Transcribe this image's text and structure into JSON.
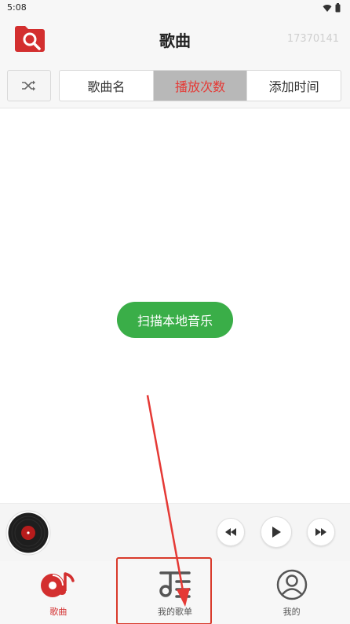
{
  "status_bar": {
    "time": "5:08"
  },
  "header": {
    "title": "歌曲",
    "user_id": "17370141"
  },
  "sort_bar": {
    "tabs": [
      {
        "label": "歌曲名",
        "active": false
      },
      {
        "label": "播放次数",
        "active": true
      },
      {
        "label": "添加时间",
        "active": false
      }
    ]
  },
  "content": {
    "scan_button_label": "扫描本地音乐"
  },
  "bottom_nav": {
    "items": [
      {
        "label": "歌曲",
        "icon": "song-disc-icon",
        "active": true
      },
      {
        "label": "我的歌单",
        "icon": "playlist-icon",
        "active": false
      },
      {
        "label": "我的",
        "icon": "profile-icon",
        "active": false
      }
    ]
  },
  "colors": {
    "accent_red": "#d32f2f",
    "active_tab_text": "#e53935",
    "scan_button_green": "#3aae48",
    "highlight_box": "#d93a2b"
  }
}
